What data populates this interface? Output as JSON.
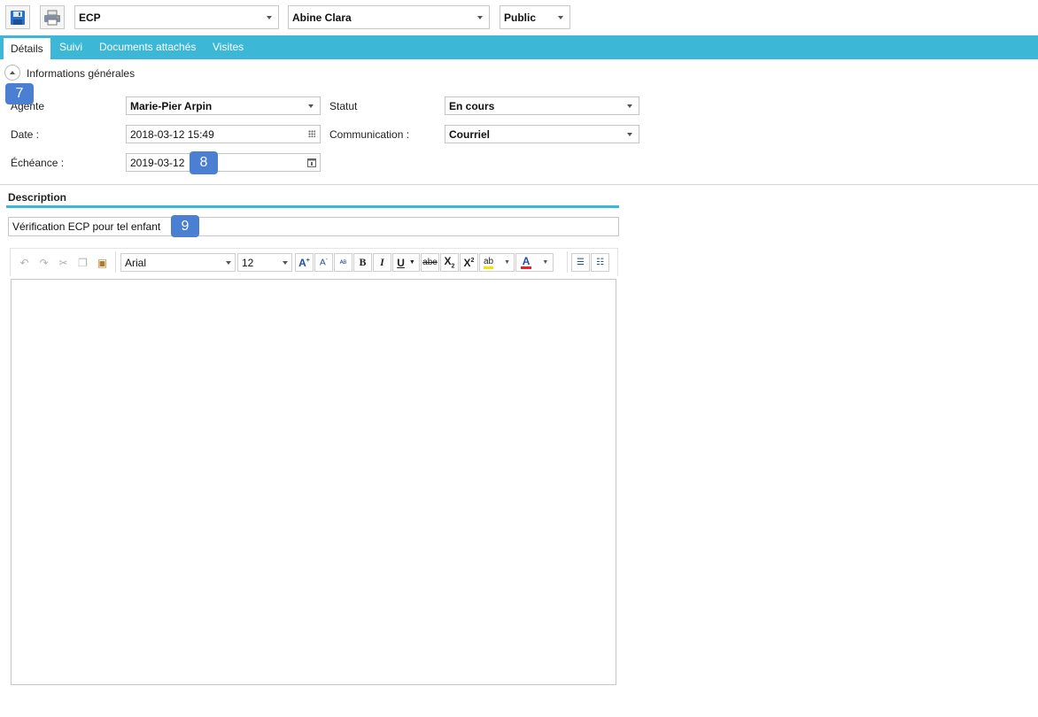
{
  "toolbar": {
    "save_icon": "floppy-disk-icon",
    "print_icon": "printer-icon",
    "category_value": "ECP",
    "person_value": "Abine Clara",
    "visibility_value": "Public"
  },
  "tabs": [
    {
      "label": "Détails",
      "active": true
    },
    {
      "label": "Suivi",
      "active": false
    },
    {
      "label": "Documents attachés",
      "active": false
    },
    {
      "label": "Visites",
      "active": false
    }
  ],
  "section": {
    "title": "Informations générales"
  },
  "form": {
    "agent_label": "Agente",
    "agent_value": "Marie-Pier Arpin",
    "statut_label": "Statut",
    "statut_value": "En cours",
    "date_label": "Date :",
    "date_value": "2018-03-12 15:49",
    "communication_label": "Communication :",
    "communication_value": "Courriel",
    "echeance_label": "Échéance :",
    "echeance_value": "2019-03-12"
  },
  "badges": {
    "b7": "7",
    "b8": "8",
    "b9": "9"
  },
  "description": {
    "title": "Description",
    "subject_value": "Vérification ECP pour tel enfant",
    "body": ""
  },
  "editor": {
    "font_value": "Arial",
    "size_value": "12"
  },
  "colors": {
    "accent": "#3cb7d6",
    "badge": "#4a7fd1"
  }
}
